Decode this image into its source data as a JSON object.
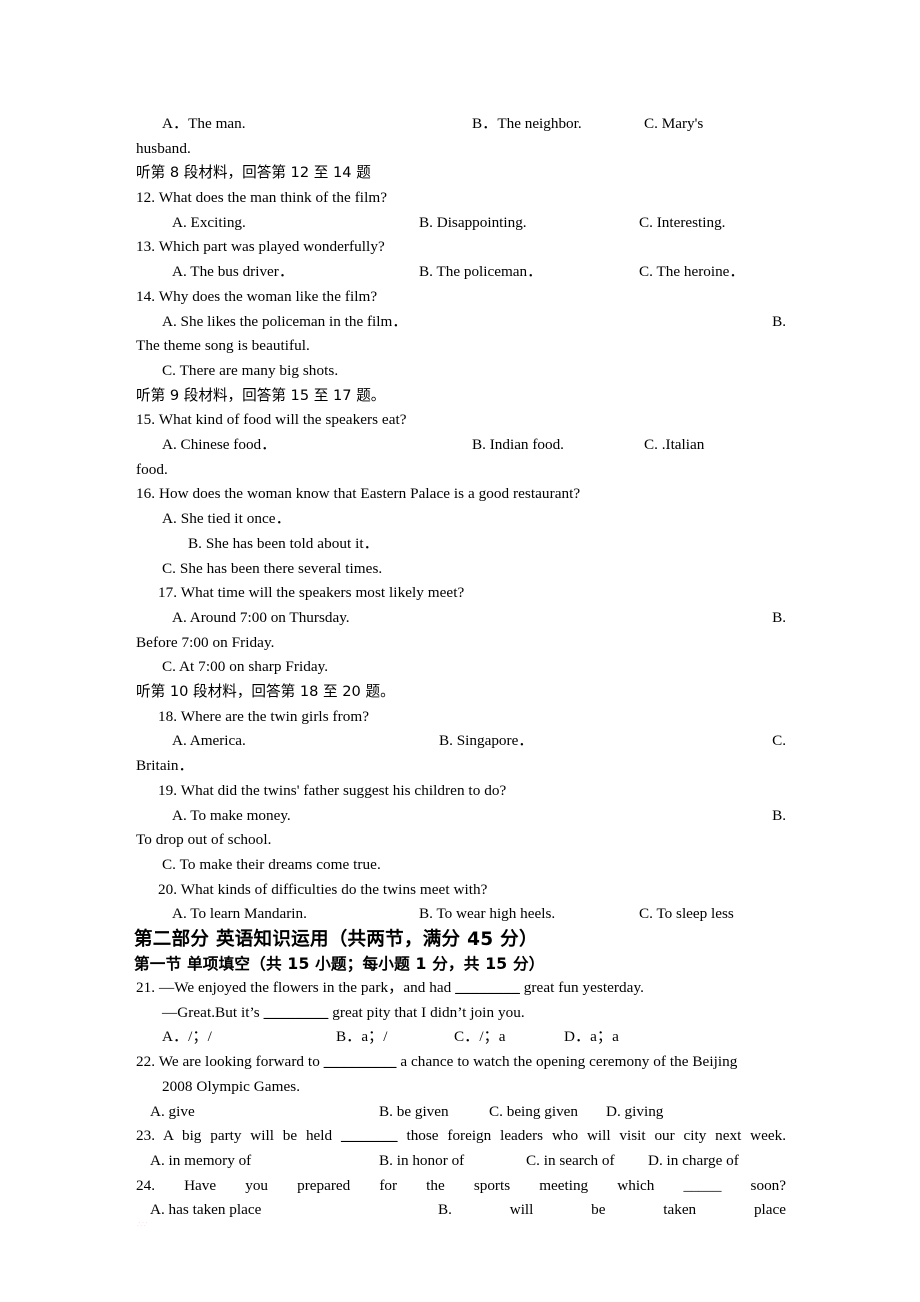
{
  "document": {
    "type": "exam-paper",
    "language": "mixed-en-zh"
  },
  "q11_options": {
    "a": "A．The man.",
    "b": "B．The neighbor.",
    "c": "C.     Mary's",
    "c_wrap": "husband."
  },
  "directions": {
    "d8": "听第 8 段材料，回答第 12 至 14 题",
    "d9": "听第 9 段材料，回答第 15 至 17 题。",
    "d10": "听第 10 段材料，回答第 18 至 20 题。"
  },
  "questions": [
    {
      "id": "q12",
      "stem": "12. What does the man think of the film?",
      "a": "A. Exciting.",
      "b": "B. Disappointing.",
      "c": "C. Interesting."
    },
    {
      "id": "q13",
      "stem": "13. Which part was played wonderfully?",
      "a": "A. The bus driver．",
      "b": "B. The policeman．",
      "c": "C. The heroine．"
    },
    {
      "id": "q14",
      "stem": "14. Why does the woman like the film?",
      "a": "A. She likes the policeman in the film．",
      "b_label": "B.",
      "b_wrap": "The theme song is beautiful.",
      "c": "C. There are many big shots."
    },
    {
      "id": "q15",
      "stem": "15. What kind of food will the speakers eat?",
      "a": "A. Chinese food．",
      "b": "B. Indian food.",
      "c": "C.      .Italian",
      "c_wrap": "food."
    },
    {
      "id": "q16",
      "stem": "16. How does the woman know that Eastern Palace is a good restaurant?",
      "a": "A. She tied it once．",
      "b": "B. She has been told about it．",
      "c": "C. She has been there several times."
    },
    {
      "id": "q17",
      "stem": "17. What time will the speakers most likely meet?",
      "a": "A. Around 7:00 on Thursday.",
      "b_label": "B.",
      "b_wrap": "Before 7:00 on Friday.",
      "c": "C. At 7:00 on sharp Friday."
    },
    {
      "id": "q18",
      "stem": "18. Where are the twin girls from?",
      "a": "A. America.",
      "b": "B. Singapore．",
      "c_label": "C.",
      "c_wrap": "Britain．"
    },
    {
      "id": "q19",
      "stem": "19. What did the twins' father suggest his children to do?",
      "a": "A. To make money.",
      "b_label": "B.",
      "b_wrap": "To drop out of school.",
      "c": "C. To make their dreams come true."
    },
    {
      "id": "q20",
      "stem": "20. What kinds of difficulties do the twins meet with?",
      "a": "A. To learn Mandarin.",
      "b": "B. To wear high heels.",
      "c": "C. To sleep less"
    }
  ],
  "part_two": {
    "heading": "第二部分   英语知识运用（共两节，满分 45 分）",
    "section_one": "第一节   单项填空（共 15 小题；每小题 1 分，共 15 分）"
  },
  "multiple_choice": [
    {
      "id": "q21",
      "line1_pre": "21. —We enjoyed the flowers in the park，and had ",
      "line1_blank": "________",
      "line1_post": " great fun yesterday.",
      "line2_pre": "—Great.But it’s ",
      "line2_blank": "________",
      "line2_post": " great pity that I didn’t join you.",
      "opt_a": "A．/；/",
      "opt_b": "B．a；/",
      "opt_c": "C．/；a",
      "opt_d": "D．a；a"
    },
    {
      "id": "q22",
      "line1_pre": "22. We are looking forward to ",
      "line1_blank": "_________",
      "line1_post": " a chance to watch the opening ceremony of the Beijing",
      "line2": "2008 Olympic Games.",
      "opt_a": "A. give",
      "opt_b": "B. be given",
      "opt_c": "C. being given",
      "opt_d": "D. giving"
    },
    {
      "id": "q23",
      "line1_pre": "23. A big party will be held ",
      "line1_blank": "_______",
      "line1_post": " those foreign leaders who will visit our city next week.",
      "opt_a": "A. in memory of",
      "opt_b": "B. in honor of",
      "opt_c": "C. in search of",
      "opt_d": "D. in charge of"
    },
    {
      "id": "q24",
      "line1_words": "24.   Have   you   prepared   for   the   sports   meeting   which   _____   soon?",
      "opt_a": "A. has taken place",
      "opt_b_words": "B.     will     be     taken     place"
    }
  ]
}
